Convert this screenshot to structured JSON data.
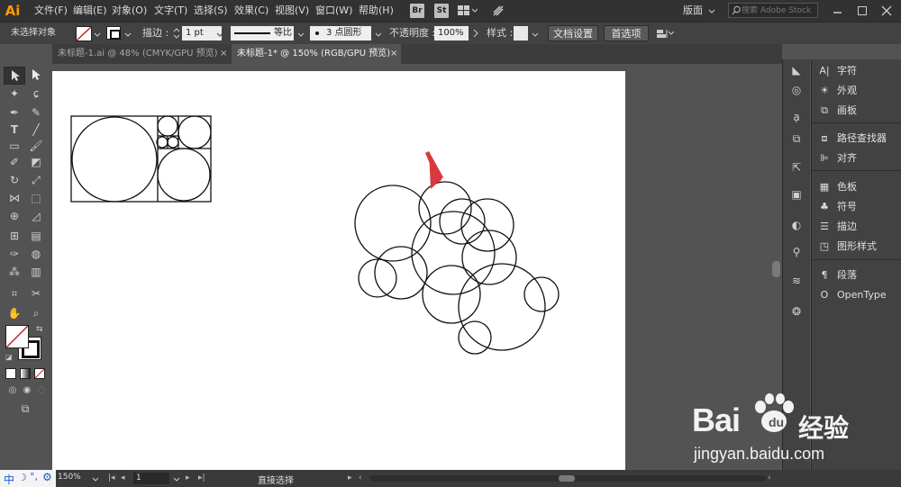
{
  "app": {
    "logo": "Ai"
  },
  "menubar": {
    "items": [
      "文件(F)",
      "编辑(E)",
      "对象(O)",
      "文字(T)",
      "选择(S)",
      "效果(C)",
      "视图(V)",
      "窗口(W)",
      "帮助(H)"
    ],
    "bridge": "Br",
    "stock": "St",
    "workspace": "版面",
    "search_placeholder": "搜索 Adobe Stock"
  },
  "controlbar": {
    "no_selection": "未选择对象",
    "stroke_label": "描边 :",
    "stroke_value": "1 pt",
    "profile_label": "等比",
    "brush_label": "3 点圆形",
    "opacity_label": "不透明度 :",
    "opacity_value": "100%",
    "style_label": "样式 :",
    "doc_setup": "文档设置",
    "preferences": "首选项"
  },
  "tabs": [
    {
      "label": "未标题-1.ai @ 48% (CMYK/GPU 预览)",
      "close": "×"
    },
    {
      "label": "未标题-1* @ 150% (RGB/GPU 预览)",
      "close": "×"
    }
  ],
  "panels": [
    {
      "label": "字符",
      "icon": "character-icon"
    },
    {
      "label": "外观",
      "icon": "appearance-icon"
    },
    {
      "label": "画板",
      "icon": "artboard-icon"
    },
    {
      "label": "路径查找器",
      "icon": "pathfinder-icon"
    },
    {
      "label": "对齐",
      "icon": "align-icon"
    },
    {
      "label": "色板",
      "icon": "swatches-icon"
    },
    {
      "label": "符号",
      "icon": "symbols-icon"
    },
    {
      "label": "描边",
      "icon": "stroke-icon"
    },
    {
      "label": "图形样式",
      "icon": "graphic-styles-icon"
    },
    {
      "label": "段落",
      "icon": "paragraph-icon"
    },
    {
      "label": "OpenType",
      "icon": "opentype-icon"
    }
  ],
  "statusbar": {
    "ime": "中",
    "zoom": "150%",
    "artboard_number": "1",
    "tool_status": "直接选择"
  },
  "watermark": {
    "brand": "Bai",
    "brand_suffix": "经验",
    "url": "jingyan.baidu.com"
  },
  "colors": {
    "accent_logo": "#ff9a00",
    "arrow": "#d9393e"
  }
}
